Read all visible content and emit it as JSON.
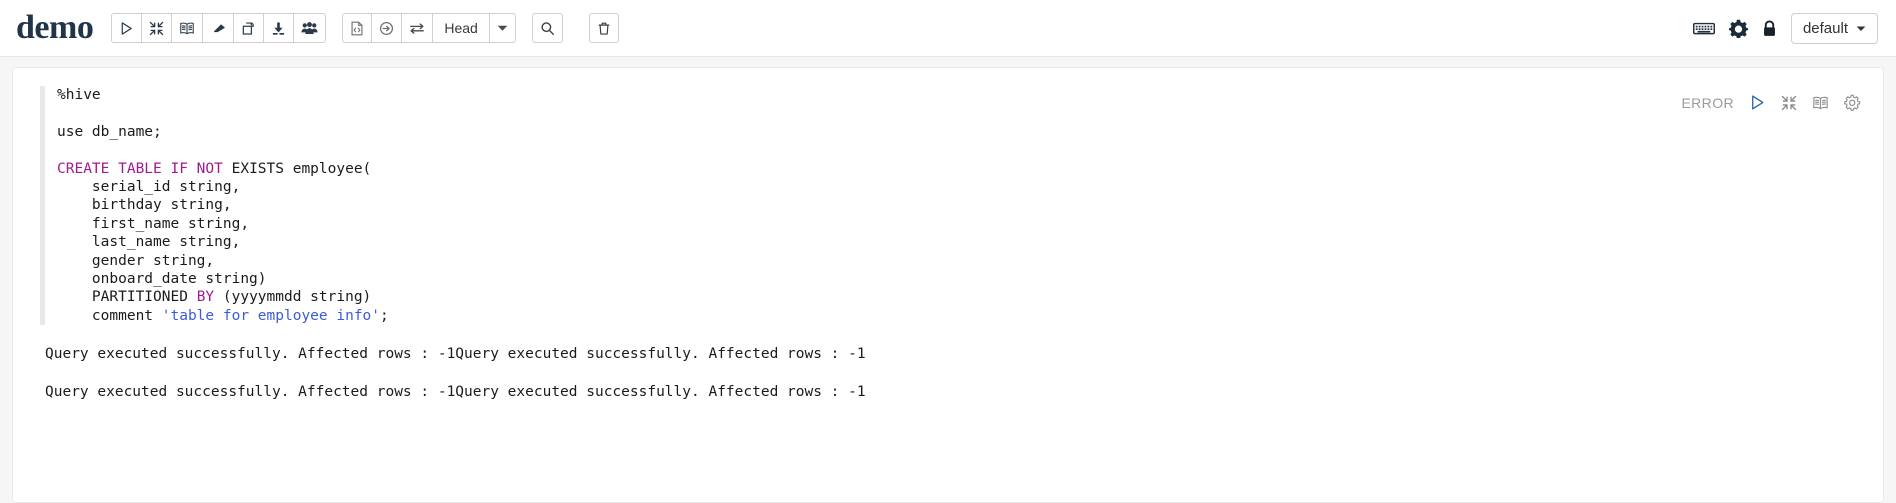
{
  "header": {
    "brand": "demo",
    "toolbar_main": [
      {
        "name": "run-all-paragraphs-button",
        "icon": "play-icon"
      },
      {
        "name": "collapse-all-button",
        "icon": "collapse-arrows-icon"
      },
      {
        "name": "show-hide-code-button",
        "icon": "book-icon"
      },
      {
        "name": "clear-output-button",
        "icon": "eraser-icon"
      },
      {
        "name": "clone-notebook-button",
        "icon": "copy-icon"
      },
      {
        "name": "export-notebook-button",
        "icon": "download-icon"
      },
      {
        "name": "permissions-button",
        "icon": "users-icon"
      }
    ],
    "toolbar_version": [
      {
        "name": "code-view-button",
        "icon": "code-file-icon"
      },
      {
        "name": "commit-button",
        "icon": "circle-arrow-right-icon"
      },
      {
        "name": "revision-compare-button",
        "icon": "swap-arrows-icon"
      }
    ],
    "revision_label": "Head",
    "revision_caret": "caret-down-icon",
    "search_button": {
      "name": "search-button",
      "icon": "search-icon"
    },
    "trash_button": {
      "name": "delete-notebook-button",
      "icon": "trash-icon"
    },
    "right_icons": [
      {
        "name": "keyboard-shortcuts-icon",
        "icon": "keyboard-icon"
      },
      {
        "name": "settings-icon",
        "icon": "gear-icon"
      },
      {
        "name": "permissions-lock-icon",
        "icon": "lock-icon"
      }
    ],
    "interpreter_binding": "default"
  },
  "paragraph": {
    "status": "ERROR",
    "controls": [
      {
        "name": "run-paragraph-button",
        "icon": "play-icon"
      },
      {
        "name": "hide-editor-button",
        "icon": "collapse-arrows-icon"
      },
      {
        "name": "hide-output-button",
        "icon": "book-icon"
      },
      {
        "name": "paragraph-settings-button",
        "icon": "gear-icon"
      }
    ],
    "code_lines": [
      [
        {
          "t": "%hive",
          "c": ""
        }
      ],
      [
        {
          "t": "",
          "c": ""
        }
      ],
      [
        {
          "t": "use db_name;",
          "c": ""
        }
      ],
      [
        {
          "t": "",
          "c": ""
        }
      ],
      [
        {
          "t": "CREATE TABLE IF NOT",
          "c": "kw"
        },
        {
          "t": " EXISTS employee(",
          "c": ""
        }
      ],
      [
        {
          "t": "    serial_id string,",
          "c": ""
        }
      ],
      [
        {
          "t": "    birthday string,",
          "c": ""
        }
      ],
      [
        {
          "t": "    first_name string,",
          "c": ""
        }
      ],
      [
        {
          "t": "    last_name string,",
          "c": ""
        }
      ],
      [
        {
          "t": "    gender string,",
          "c": ""
        }
      ],
      [
        {
          "t": "    onboard_date string)",
          "c": ""
        }
      ],
      [
        {
          "t": "    PARTITIONED ",
          "c": ""
        },
        {
          "t": "BY",
          "c": "kw"
        },
        {
          "t": " (yyyymmdd string)",
          "c": ""
        }
      ],
      [
        {
          "t": "    comment ",
          "c": ""
        },
        {
          "t": "'table for employee info'",
          "c": "str"
        },
        {
          "t": ";",
          "c": ""
        }
      ]
    ],
    "output_lines": [
      "Query executed successfully. Affected rows : -1Query executed successfully. Affected rows : -1",
      "Query executed successfully. Affected rows : -1Query executed successfully. Affected rows : -1"
    ]
  },
  "colors": {
    "keyword": "#a11a8e",
    "string": "#3b5bdb",
    "status": "#9b9b9b",
    "accent": "#3071a9",
    "brand": "#21354a"
  }
}
